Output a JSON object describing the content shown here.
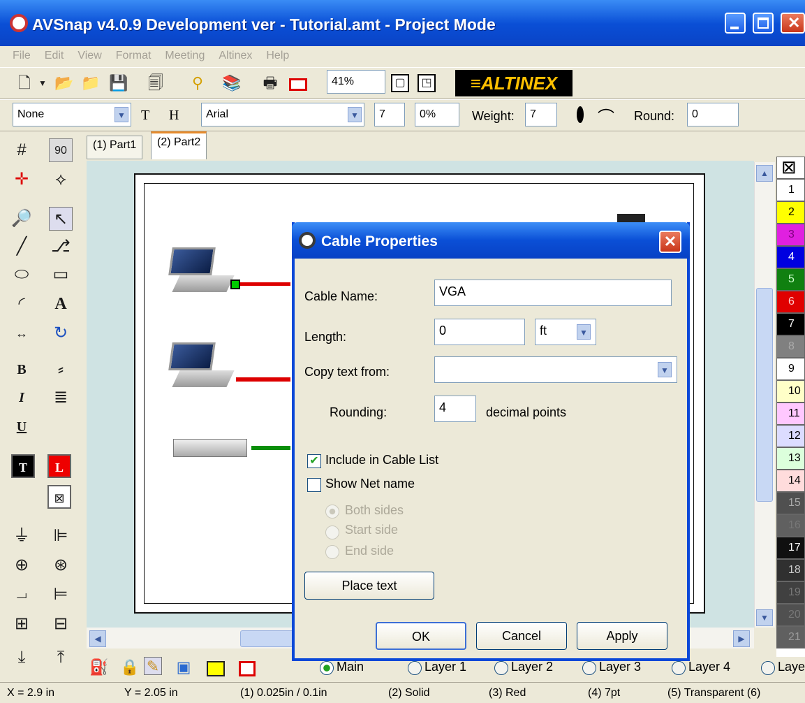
{
  "window": {
    "title": "AVSnap v4.0.9 Development ver - Tutorial.amt  - Project Mode"
  },
  "menu": [
    "File",
    "Edit",
    "View",
    "Format",
    "Meeting",
    "Altinex",
    "Help"
  ],
  "toolbar": {
    "zoom": "41%",
    "brand": "≡ALTINEX"
  },
  "format": {
    "style": "None",
    "t_label": "T",
    "h_label": "H",
    "font": "Arial",
    "size": "7",
    "percent": "0%",
    "weight_label": "Weight:",
    "weight": "7",
    "round_label": "Round:",
    "round": "0"
  },
  "tabs": [
    "(1) Part1",
    "(2) Part2"
  ],
  "palette": [
    {
      "label": "1",
      "color": "#ffffff",
      "text": "#000"
    },
    {
      "label": "2",
      "color": "#ffff00",
      "text": "#000"
    },
    {
      "label": "3",
      "color": "#e020e0",
      "text": "#800080"
    },
    {
      "label": "4",
      "color": "#0000e0",
      "text": "#fff"
    },
    {
      "label": "5",
      "color": "#108010",
      "text": "#cfc"
    },
    {
      "label": "6",
      "color": "#e00000",
      "text": "#fcc"
    },
    {
      "label": "7",
      "color": "#000000",
      "text": "#fff"
    },
    {
      "label": "8",
      "color": "#808080",
      "text": "#aaa"
    },
    {
      "label": "9",
      "color": "#ffffff",
      "text": "#000"
    },
    {
      "label": "10",
      "color": "#ffffc8",
      "text": "#000"
    },
    {
      "label": "11",
      "color": "#ffc8ff",
      "text": "#000"
    },
    {
      "label": "12",
      "color": "#dcdcff",
      "text": "#000"
    },
    {
      "label": "13",
      "color": "#dcffdc",
      "text": "#000"
    },
    {
      "label": "14",
      "color": "#ffdcdc",
      "text": "#000"
    },
    {
      "label": "15",
      "color": "#505050",
      "text": "#aaa"
    },
    {
      "label": "16",
      "color": "#606060",
      "text": "#777"
    },
    {
      "label": "17",
      "color": "#101010",
      "text": "#fff"
    },
    {
      "label": "18",
      "color": "#303030",
      "text": "#ccc"
    },
    {
      "label": "19",
      "color": "#404040",
      "text": "#777"
    },
    {
      "label": "20",
      "color": "#505050",
      "text": "#777"
    },
    {
      "label": "21",
      "color": "#606060",
      "text": "#999"
    }
  ],
  "layers": [
    "Main",
    "Layer 1",
    "Layer 2",
    "Layer 3",
    "Layer 4",
    "Laye"
  ],
  "status": {
    "x": "X = 2.9 in",
    "y": "Y = 2.05 in",
    "grid": "(1) 0.025in / 0.1in",
    "line": "(2) Solid",
    "color": "(3) Red",
    "width": "(4) 7pt",
    "fill": "(5) Transparent (6)"
  },
  "dialog": {
    "title": "Cable Properties",
    "cable_name_label": "Cable Name:",
    "cable_name": "VGA",
    "length_label": "Length:",
    "length": "0",
    "unit": "ft",
    "copy_label": "Copy text from:",
    "copy_value": "",
    "rounding_label": "Rounding:",
    "rounding": "4",
    "decimal_label": "decimal points",
    "include_label": "Include in Cable List",
    "include_checked": "✔",
    "shownet_label": "Show Net name",
    "both": "Both sides",
    "start": "Start side",
    "end": "End side",
    "place_text": "Place text",
    "ok": "OK",
    "cancel": "Cancel",
    "apply": "Apply"
  }
}
